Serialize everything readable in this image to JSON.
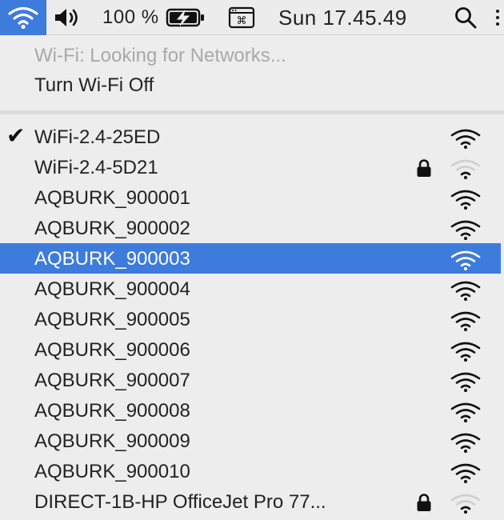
{
  "menubar": {
    "battery_percent": "100 %",
    "clock": "Sun 17.45.49",
    "accent_color": "#3d7bdc"
  },
  "wifi_menu": {
    "status": "Wi-Fi: Looking for Networks...",
    "toggle_label": "Turn Wi-Fi Off",
    "networks": [
      {
        "name": "WiFi-2.4-25ED",
        "connected": true,
        "locked": false,
        "signal": "full"
      },
      {
        "name": "WiFi-2.4-5D21",
        "connected": false,
        "locked": true,
        "signal": "weak"
      },
      {
        "name": "AQBURK_900001",
        "connected": false,
        "locked": false,
        "signal": "full"
      },
      {
        "name": "AQBURK_900002",
        "connected": false,
        "locked": false,
        "signal": "full"
      },
      {
        "name": "AQBURK_900003",
        "connected": false,
        "locked": false,
        "signal": "full",
        "highlighted": true
      },
      {
        "name": "AQBURK_900004",
        "connected": false,
        "locked": false,
        "signal": "full"
      },
      {
        "name": "AQBURK_900005",
        "connected": false,
        "locked": false,
        "signal": "full"
      },
      {
        "name": "AQBURK_900006",
        "connected": false,
        "locked": false,
        "signal": "full"
      },
      {
        "name": "AQBURK_900007",
        "connected": false,
        "locked": false,
        "signal": "full"
      },
      {
        "name": "AQBURK_900008",
        "connected": false,
        "locked": false,
        "signal": "full"
      },
      {
        "name": "AQBURK_900009",
        "connected": false,
        "locked": false,
        "signal": "full"
      },
      {
        "name": "AQBURK_900010",
        "connected": false,
        "locked": false,
        "signal": "full"
      },
      {
        "name": "DIRECT-1B-HP OfficeJet Pro 77...",
        "connected": false,
        "locked": true,
        "signal": "weak"
      }
    ]
  }
}
